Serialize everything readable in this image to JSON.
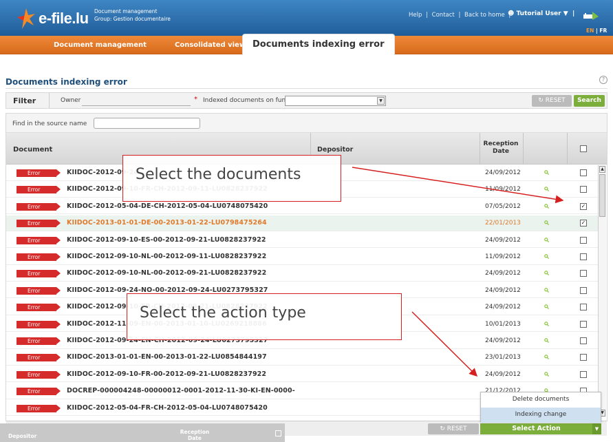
{
  "header": {
    "logo_text": "e-file.lu",
    "app_title": "Document management",
    "app_group": "Group: Gestion documentaire",
    "links": [
      "Help",
      "|",
      "Contact",
      "|",
      "Back to home",
      "|"
    ],
    "user": "Tutorial User",
    "lang_en": "EN",
    "lang_sep": "|",
    "lang_fr": "FR"
  },
  "nav": {
    "tabs": [
      {
        "label": "Document management"
      },
      {
        "label": "Consolidated view"
      },
      {
        "label": "Documents indexing error"
      }
    ]
  },
  "page": {
    "title": "Documents indexing error",
    "help": "?"
  },
  "filter": {
    "label": "Filter",
    "owner_label": "Owner",
    "required_mark": "*",
    "fund_label": "Indexed documents on fund",
    "reset": "RESET",
    "search": "Search"
  },
  "grid": {
    "find_label": "Find in the source name",
    "columns": {
      "document": "Document",
      "depositor": "Depositor",
      "reception_date": "Reception Date"
    },
    "rows": [
      {
        "status": "Error",
        "name": "KIIDOC-2012-09-24-",
        "date": "24/09/2012",
        "checked": false
      },
      {
        "status": "Error",
        "name": "KIIDOC-2012-09-10-FR-CH-2012-09-11-LU0828237922",
        "date": "11/09/2012",
        "checked": false
      },
      {
        "status": "Error",
        "name": "KIIDOC-2012-05-04-DE-CH-2012-05-04-LU0748075420",
        "date": "07/05/2012",
        "checked": true
      },
      {
        "status": "Error",
        "name": "KIIDOC-2013-01-01-DE-00-2013-01-22-LU0798475264",
        "date": "22/01/2013",
        "checked": true
      },
      {
        "status": "Error",
        "name": "KIIDOC-2012-09-10-ES-00-2012-09-21-LU0828237922",
        "date": "24/09/2012",
        "checked": false
      },
      {
        "status": "Error",
        "name": "KIIDOC-2012-09-10-NL-00-2012-09-11-LU0828237922",
        "date": "11/09/2012",
        "checked": false
      },
      {
        "status": "Error",
        "name": "KIIDOC-2012-09-10-NL-00-2012-09-21-LU0828237922",
        "date": "24/09/2012",
        "checked": false
      },
      {
        "status": "Error",
        "name": "KIIDOC-2012-09-24-NO-00-2012-09-24-LU0273795327",
        "date": "24/09/2012",
        "checked": false
      },
      {
        "status": "Error",
        "name": "KIIDOC-2012-09-10-FR-CH-2012-09-21-LU0828237922",
        "date": "24/09/2012",
        "checked": false
      },
      {
        "status": "Error",
        "name": "KIIDOC-2012-11-09-EN-00-2013-01-10-LU0269218886",
        "date": "10/01/2013",
        "checked": false
      },
      {
        "status": "Error",
        "name": "KIIDOC-2012-09-24-EN-CH-2012-09-24-LU0273795327",
        "date": "24/09/2012",
        "checked": false
      },
      {
        "status": "Error",
        "name": "KIIDOC-2013-01-01-EN-00-2013-01-22-LU0854844197",
        "date": "23/01/2013",
        "checked": false
      },
      {
        "status": "Error",
        "name": "KIIDOC-2012-09-10-FR-00-2012-09-21-LU0828237922",
        "date": "24/09/2012",
        "checked": false
      },
      {
        "status": "Error",
        "name": "DOCREP-000004248-00000012-0001-2012-11-30-KI-EN-0000-",
        "date": "21/12/2012",
        "checked": false
      },
      {
        "status": "Error",
        "name": "KIIDOC-2012-05-04-FR-CH-2012-05-04-LU0748075420",
        "date": "",
        "checked": false
      }
    ],
    "reset": "RESET",
    "select_action": "Select Action"
  },
  "action_menu": {
    "items": [
      "Delete documents",
      "Indexing change"
    ]
  },
  "annotations": {
    "callout_1": "Select the documents",
    "callout_2": "Select the action type"
  },
  "ghost_header": {
    "depositor": "Depositor",
    "reception": "Reception Date"
  },
  "colors": {
    "header_blue": "#2a6fb0",
    "nav_orange": "#e47a2a",
    "error_red": "#d62b2b",
    "action_green": "#7cae3c",
    "highlight_orange": "#e07a2c",
    "callout_red": "#d62020"
  }
}
